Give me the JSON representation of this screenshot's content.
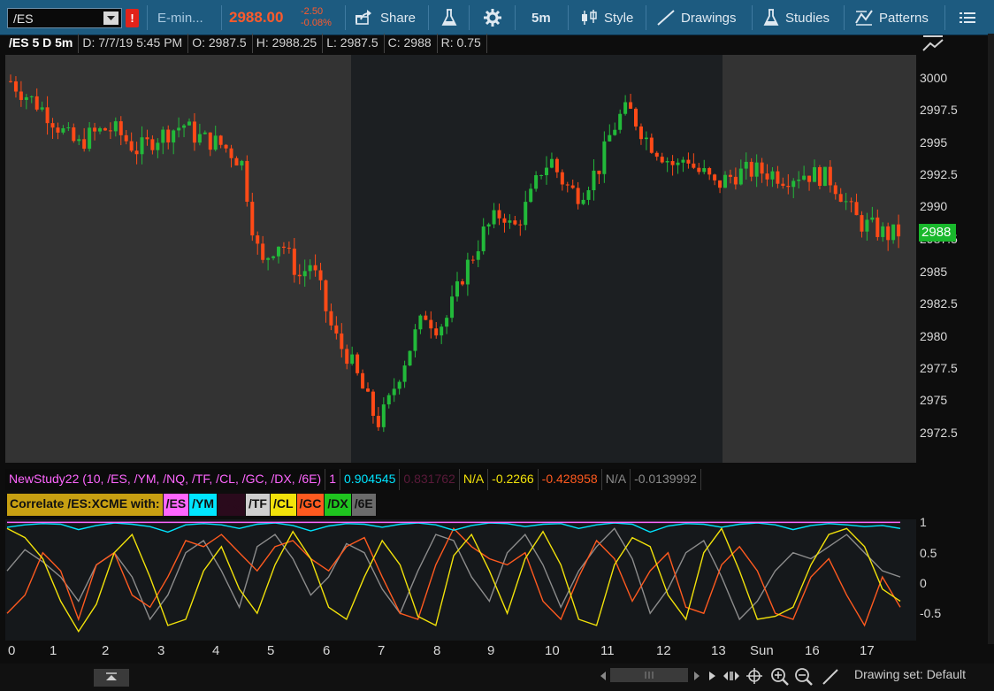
{
  "toolbar": {
    "symbol": "/ES",
    "alert_badge": "!",
    "description": "E-min...",
    "last_price": "2988.00",
    "net_change": "-2.50",
    "pct_change": "-0.08%",
    "share_label": "Share",
    "timeframe_label": "5m",
    "style_label": "Style",
    "drawings_label": "Drawings",
    "studies_label": "Studies",
    "patterns_label": "Patterns"
  },
  "header": {
    "symbol_period": "/ES 5 D 5m",
    "date": "D: 7/7/19 5:45 PM",
    "open": "O: 2987.5",
    "high": "H: 2988.25",
    "low": "L: 2987.5",
    "close": "C: 2988",
    "range": "R: 0.75"
  },
  "price_axis": {
    "ticks": [
      "3000",
      "2997.5",
      "2995",
      "2992.5",
      "2990",
      "2987.5",
      "2985",
      "2982.5",
      "2980",
      "2977.5",
      "2975",
      "2972.5"
    ],
    "last_badge": "2988"
  },
  "study": {
    "title": "NewStudy22 (10, /ES, /YM, /NQ, /TF, /CL, /GC, /DX, /6E)",
    "v1": "1",
    "v2": "0.904545",
    "v3": "0.831762",
    "v4": "N/A",
    "v5": "-0.2266",
    "v6": "-0.428958",
    "v7": "N/A",
    "v8": "-0.0139992",
    "correlate_label": "Correlate /ES:XCME with:",
    "symbols": [
      "/ES",
      "/YM",
      "/NQ",
      "/TF",
      "/CL",
      "/GC",
      "/DX",
      "/6E"
    ],
    "axis_ticks": [
      "1",
      "0.5",
      "0",
      "-0.5"
    ]
  },
  "time_axis": {
    "ticks": [
      "0",
      "1",
      "2",
      "3",
      "4",
      "5",
      "6",
      "7",
      "8",
      "9",
      "10",
      "11",
      "12",
      "13",
      "Sun",
      "16",
      "17"
    ]
  },
  "bottom": {
    "drawing_set": "Drawing set: Default"
  },
  "colors": {
    "up": "#22b93a",
    "down": "#ff4a17",
    "toolbar": "#1d5b80",
    "es": "#ff66ff",
    "ym": "#00e5ff",
    "tf": "#cfcfcf",
    "cl": "#f2e20a",
    "gc": "#ff5a1f",
    "dx": "#1fc41f",
    "e6": "#6b6b6b"
  },
  "chart_data": [
    {
      "type": "candlestick",
      "title": "/ES 5 D 5m",
      "ylim": [
        2970.5,
        3001.5
      ],
      "close_path": [
        2999.5,
        2998.8,
        2998.2,
        2997.6,
        2996.9,
        2996.0,
        2995.2,
        2994.6,
        2995.3,
        2995.6,
        2995.9,
        2995.7,
        2995.0,
        2994.3,
        2994.6,
        2995.2,
        2995.5,
        2995.9,
        2996.2,
        2995.4,
        2995.1,
        2994.9,
        2994.6,
        2994.0,
        2993.2,
        2988.7,
        2985.4,
        2986.7,
        2987.4,
        2985.9,
        2984.6,
        2985.7,
        2983.9,
        2981.2,
        2979.5,
        2978.6,
        2976.9,
        2975.2,
        2973.5,
        2974.7,
        2976.8,
        2978.6,
        2980.4,
        2981.8,
        2980.9,
        2981.2,
        2983.0,
        2985.1,
        2986.4,
        2988.0,
        2988.9,
        2989.6,
        2988.1,
        2989.4,
        2990.9,
        2992.8,
        2993.5,
        2992.1,
        2991.2,
        2990.9,
        2992.0,
        2993.0,
        2995.2,
        2996.7,
        2997.4,
        2996.2,
        2995.0,
        2994.3,
        2993.6,
        2992.9,
        2993.9,
        2992.7,
        2992.4,
        2991.5,
        2992.0,
        2992.4,
        2992.6,
        2992.7,
        2992.6,
        2992.5,
        2992.2,
        2992.3,
        2992.5,
        2992.4,
        2992.3,
        2992.0,
        2991.0,
        2989.7,
        2988.7,
        2988.5,
        2988.1,
        2987.8,
        2988.0
      ]
    },
    {
      "type": "line",
      "title": "NewStudy22 (10, /ES, /YM, /NQ, /TF, /CL, /GC, /DX, /6E)",
      "ylim": [
        -0.95,
        1.05
      ],
      "series": [
        {
          "name": "/ES",
          "values": [
            1,
            1,
            1,
            1,
            1,
            1,
            1,
            1,
            1,
            1,
            1,
            1,
            1,
            1,
            1,
            1,
            1,
            1,
            1,
            1,
            1,
            1,
            1,
            1,
            1,
            1,
            1,
            1,
            1,
            1,
            1,
            1,
            1,
            1,
            1,
            1,
            1,
            1,
            1,
            1,
            1,
            1,
            1,
            1,
            1,
            1,
            1,
            1,
            1,
            1,
            1
          ]
        },
        {
          "name": "/YM",
          "values": [
            0.92,
            0.96,
            0.98,
            0.97,
            0.88,
            0.95,
            0.99,
            0.97,
            0.93,
            0.84,
            0.96,
            0.98,
            0.96,
            0.9,
            0.97,
            0.99,
            0.95,
            0.86,
            0.94,
            0.98,
            0.97,
            0.92,
            0.97,
            0.99,
            0.96,
            0.87,
            0.95,
            0.99,
            0.98,
            0.93,
            0.97,
            0.98,
            0.9,
            0.96,
            0.99,
            0.97,
            0.84,
            0.94,
            0.98,
            0.97,
            0.92,
            0.97,
            0.99,
            0.96,
            0.88,
            0.95,
            0.98,
            0.96,
            0.93,
            0.95,
            0.9
          ]
        },
        {
          "name": "/CL",
          "values": [
            0.9,
            0.75,
            0.4,
            -0.3,
            -0.8,
            -0.35,
            0.5,
            0.8,
            0.1,
            -0.7,
            -0.6,
            0.2,
            0.6,
            -0.1,
            -0.5,
            0.3,
            0.85,
            0.4,
            -0.4,
            -0.6,
            0.1,
            0.7,
            0.3,
            -0.55,
            -0.7,
            0.45,
            0.8,
            0.2,
            -0.5,
            0.4,
            0.85,
            0.3,
            -0.6,
            -0.7,
            0.3,
            0.75,
            0.6,
            -0.2,
            -0.6,
            0.5,
            0.9,
            0.2,
            -0.6,
            -0.55,
            -0.4,
            0.3,
            0.8,
            0.9,
            0.6,
            -0.1,
            -0.3
          ]
        },
        {
          "name": "/GC",
          "values": [
            -0.5,
            -0.2,
            0.5,
            0.2,
            -0.6,
            0.3,
            0.5,
            -0.2,
            -0.4,
            0.1,
            0.7,
            0.6,
            0.8,
            0.5,
            0.2,
            0.6,
            0.7,
            0.4,
            0.2,
            0.6,
            0.75,
            0.1,
            -0.5,
            -0.6,
            0.3,
            0.9,
            0.6,
            0.4,
            0.3,
            0.5,
            -0.3,
            -0.6,
            0.1,
            0.7,
            0.4,
            -0.3,
            0.2,
            0.5,
            -0.4,
            -0.5,
            0.3,
            0.6,
            0.2,
            -0.5,
            -0.6,
            0.1,
            0.4,
            -0.2,
            -0.7,
            0.1,
            -0.4
          ]
        },
        {
          "name": "/TF",
          "values": [
            0.2,
            0.55,
            0.35,
            0.1,
            -0.3,
            0.3,
            0.5,
            0.1,
            -0.6,
            -0.2,
            0.5,
            0.7,
            0.2,
            -0.4,
            0.6,
            0.8,
            0.4,
            -0.2,
            0.1,
            0.65,
            0.5,
            -0.1,
            -0.5,
            0.2,
            0.8,
            0.7,
            0.1,
            -0.3,
            0.5,
            0.8,
            0.3,
            -0.4,
            0.2,
            0.6,
            0.9,
            0.4,
            -0.5,
            -0.1,
            0.5,
            0.7,
            0.1,
            -0.6,
            -0.3,
            0.2,
            0.5,
            0.4,
            0.6,
            0.8,
            0.5,
            0.2,
            0.1
          ]
        }
      ]
    }
  ]
}
